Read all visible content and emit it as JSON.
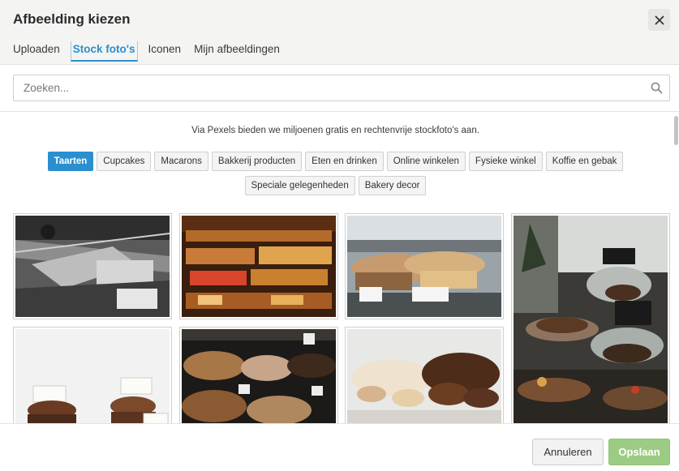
{
  "dialog": {
    "title": "Afbeelding kiezen",
    "close_icon": "close-icon"
  },
  "tabs": [
    {
      "label": "Uploaden",
      "active": false
    },
    {
      "label": "Stock foto's",
      "active": true
    },
    {
      "label": "Iconen",
      "active": false
    },
    {
      "label": "Mijn afbeeldingen",
      "active": false
    }
  ],
  "search": {
    "placeholder": "Zoeken...",
    "value": "",
    "icon": "search-icon"
  },
  "intro_text": "Via Pexels bieden we miljoenen gratis en rechtenvrije stockfoto's aan.",
  "categories": [
    {
      "label": "Taarten",
      "active": true
    },
    {
      "label": "Cupcakes",
      "active": false
    },
    {
      "label": "Macarons",
      "active": false
    },
    {
      "label": "Bakkerij producten",
      "active": false
    },
    {
      "label": "Eten en drinken",
      "active": false
    },
    {
      "label": "Online winkelen",
      "active": false
    },
    {
      "label": "Fysieke winkel",
      "active": false
    },
    {
      "label": "Koffie en gebak",
      "active": false
    },
    {
      "label": "Speciale gelegenheden",
      "active": false
    },
    {
      "label": "Bakery decor",
      "active": false
    }
  ],
  "photos": [
    {
      "name": "cake-display-case-bw"
    },
    {
      "name": "pastry-shelves-warm"
    },
    {
      "name": "carrot-cake-lemon-polenta"
    },
    {
      "name": "cake-stands-chalk-labels"
    },
    {
      "name": "red-velvet-carrot-cake-labels"
    },
    {
      "name": "cakes-display-numbered"
    },
    {
      "name": "meringues-and-chocolate-tarts"
    }
  ],
  "footer": {
    "cancel_label": "Annuleren",
    "save_label": "Opslaan"
  },
  "colors": {
    "accent": "#2a8fcf",
    "save_button": "#9ccc83",
    "header_bg": "#f4f4f3"
  }
}
